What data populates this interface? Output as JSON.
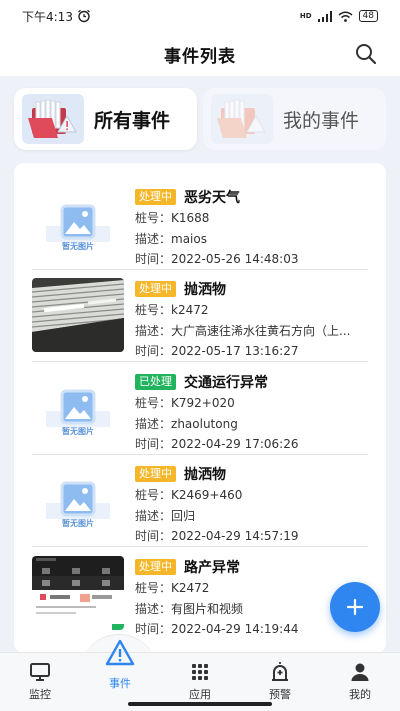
{
  "status_bar": {
    "time": "下午4:13",
    "network": "HD",
    "battery": "48"
  },
  "header": {
    "title": "事件列表"
  },
  "tabs": [
    {
      "label": "所有事件",
      "active": true
    },
    {
      "label": "我的事件",
      "active": false
    }
  ],
  "labels": {
    "pile": "桩号：",
    "desc": "描述：",
    "time": "时间："
  },
  "events": [
    {
      "status": "处理中",
      "status_type": "processing",
      "title": "恶劣天气",
      "pile": "K1688",
      "desc": "maios",
      "time": "2022-05-26 14:48:03",
      "thumb": "placeholder",
      "thumb_caption": "暂无图片"
    },
    {
      "status": "处理中",
      "status_type": "processing",
      "title": "抛洒物",
      "pile": "k2472",
      "desc": "大广高速往浠水往黄石方向（上...",
      "time": "2022-05-17 13:16:27",
      "thumb": "photo-ceiling"
    },
    {
      "status": "已处理",
      "status_type": "done",
      "title": "交通运行异常",
      "pile": "K792+020",
      "desc": "zhaolutong",
      "time": "2022-04-29 17:06:26",
      "thumb": "placeholder",
      "thumb_caption": "暂无图片"
    },
    {
      "status": "处理中",
      "status_type": "processing",
      "title": "抛洒物",
      "pile": "K2469+460",
      "desc": "回归",
      "time": "2022-04-29 14:57:19",
      "thumb": "placeholder",
      "thumb_caption": "暂无图片"
    },
    {
      "status": "处理中",
      "status_type": "processing",
      "title": "路产异常",
      "pile": "K2472",
      "desc": "有图片和视频",
      "time": "2022-04-29 14:19:44",
      "thumb": "photo-screenshot"
    }
  ],
  "bottom_nav": [
    {
      "label": "监控",
      "icon": "monitor-icon",
      "active": false
    },
    {
      "label": "事件",
      "icon": "warning-icon",
      "active": true
    },
    {
      "label": "应用",
      "icon": "apps-grid-icon",
      "active": false
    },
    {
      "label": "预警",
      "icon": "alarm-icon",
      "active": false
    },
    {
      "label": "我的",
      "icon": "user-icon",
      "active": false
    }
  ],
  "colors": {
    "accent": "#2f86f0",
    "processing": "#f5b729",
    "done": "#22b35e",
    "background": "#eef1f7"
  }
}
